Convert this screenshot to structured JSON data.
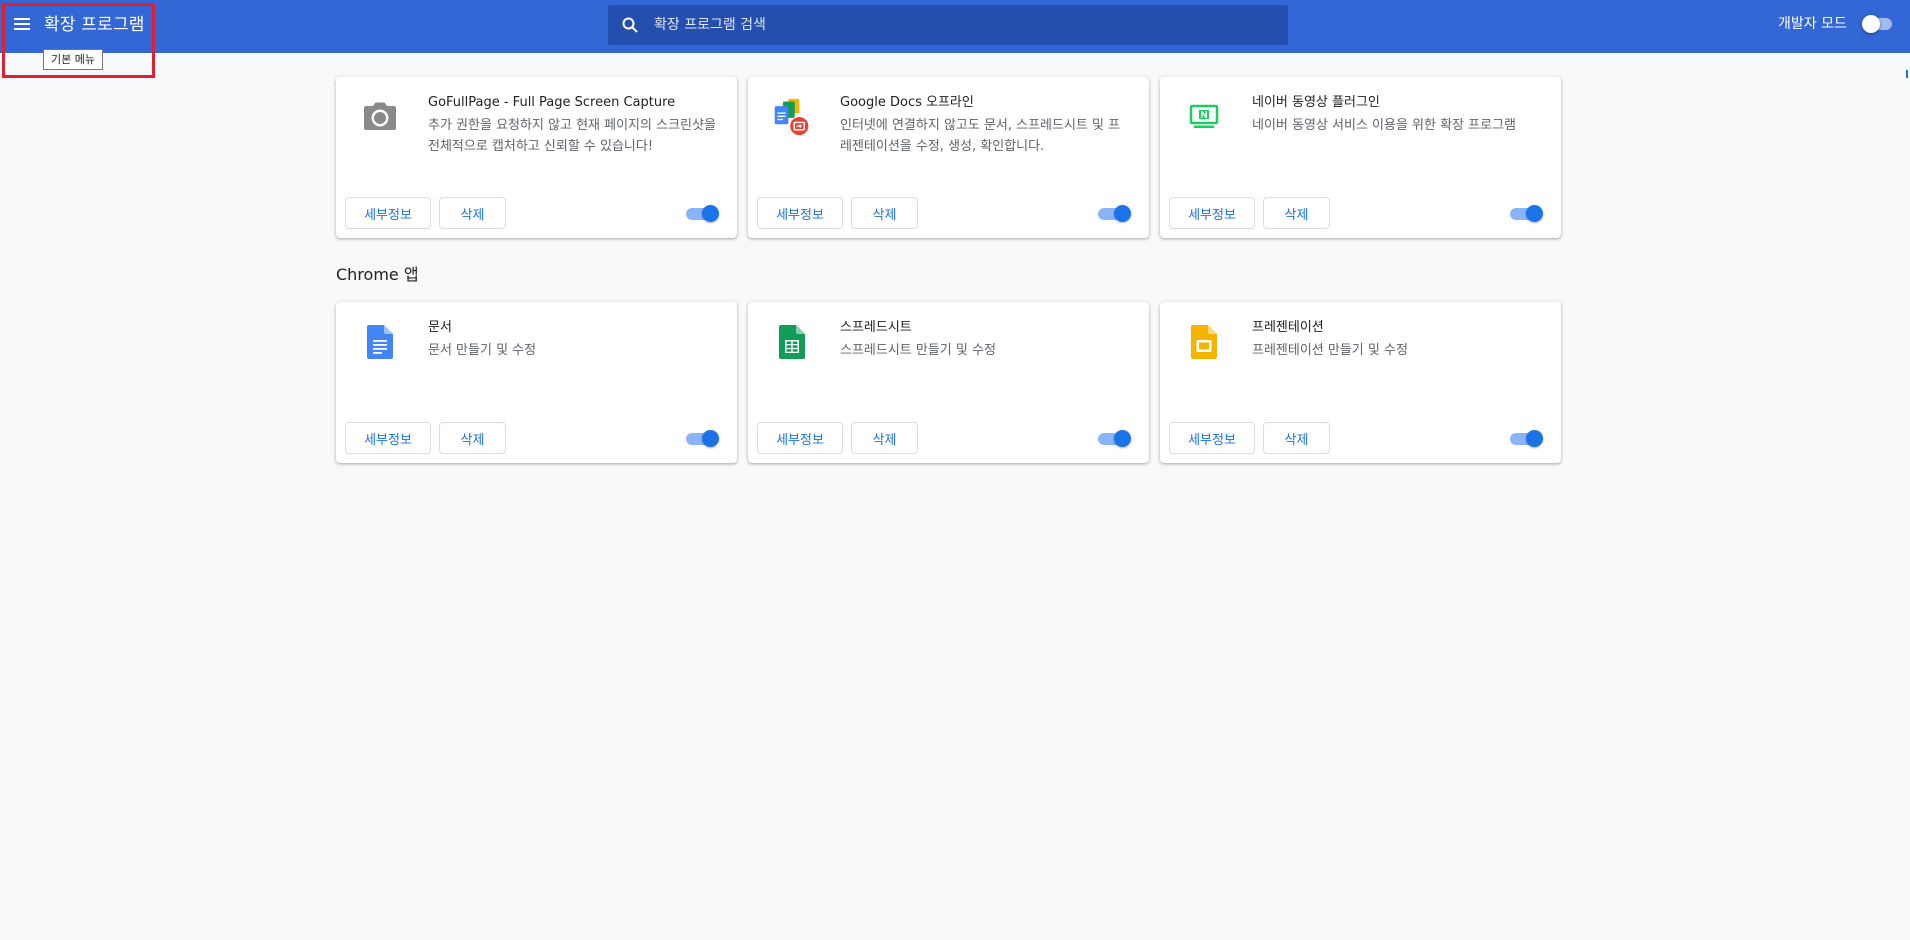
{
  "toolbar": {
    "menu_tooltip": "기본 메뉴",
    "title": "확장 프로그램",
    "search_placeholder": "확장 프로그램 검색",
    "dev_mode_label": "개발자 모드",
    "dev_mode_enabled": false
  },
  "buttons": {
    "details": "세부정보",
    "remove": "삭제"
  },
  "extensions": [
    {
      "name": "GoFullPage - Full Page Screen Capture",
      "description": "추가 권한을 요청하지 않고 현재 페이지의 스크린샷을 전체적으로 캡처하고 신뢰할 수 있습니다!",
      "icon": "camera-icon",
      "enabled": true
    },
    {
      "name": "Google Docs 오프라인",
      "description": "인터넷에 연결하지 않고도 문서, 스프레드시트 및 프레젠테이션을 수정, 생성, 확인합니다.",
      "icon": "google-docs-offline-icon",
      "enabled": true
    },
    {
      "name": "네이버 동영상 플러그인",
      "description": "네이버 동영상 서비스 이용을 위한 확장 프로그램",
      "icon": "naver-video-icon",
      "enabled": true
    }
  ],
  "apps_section": {
    "title": "Chrome 앱",
    "items": [
      {
        "name": "문서",
        "description": "문서 만들기 및 수정",
        "icon": "docs-icon",
        "enabled": true
      },
      {
        "name": "스프레드시트",
        "description": "스프레드시트 만들기 및 수정",
        "icon": "sheets-icon",
        "enabled": true
      },
      {
        "name": "프레젠테이션",
        "description": "프레젠테이션 만들기 및 수정",
        "icon": "slides-icon",
        "enabled": true
      }
    ]
  },
  "colors": {
    "toolbar": "#3367d6",
    "search_bg": "#254fae",
    "accent": "#1a73e8",
    "toggle_track": "#8ab4f8",
    "highlight": "#e0202e",
    "page_bg": "#f8f9fa"
  }
}
